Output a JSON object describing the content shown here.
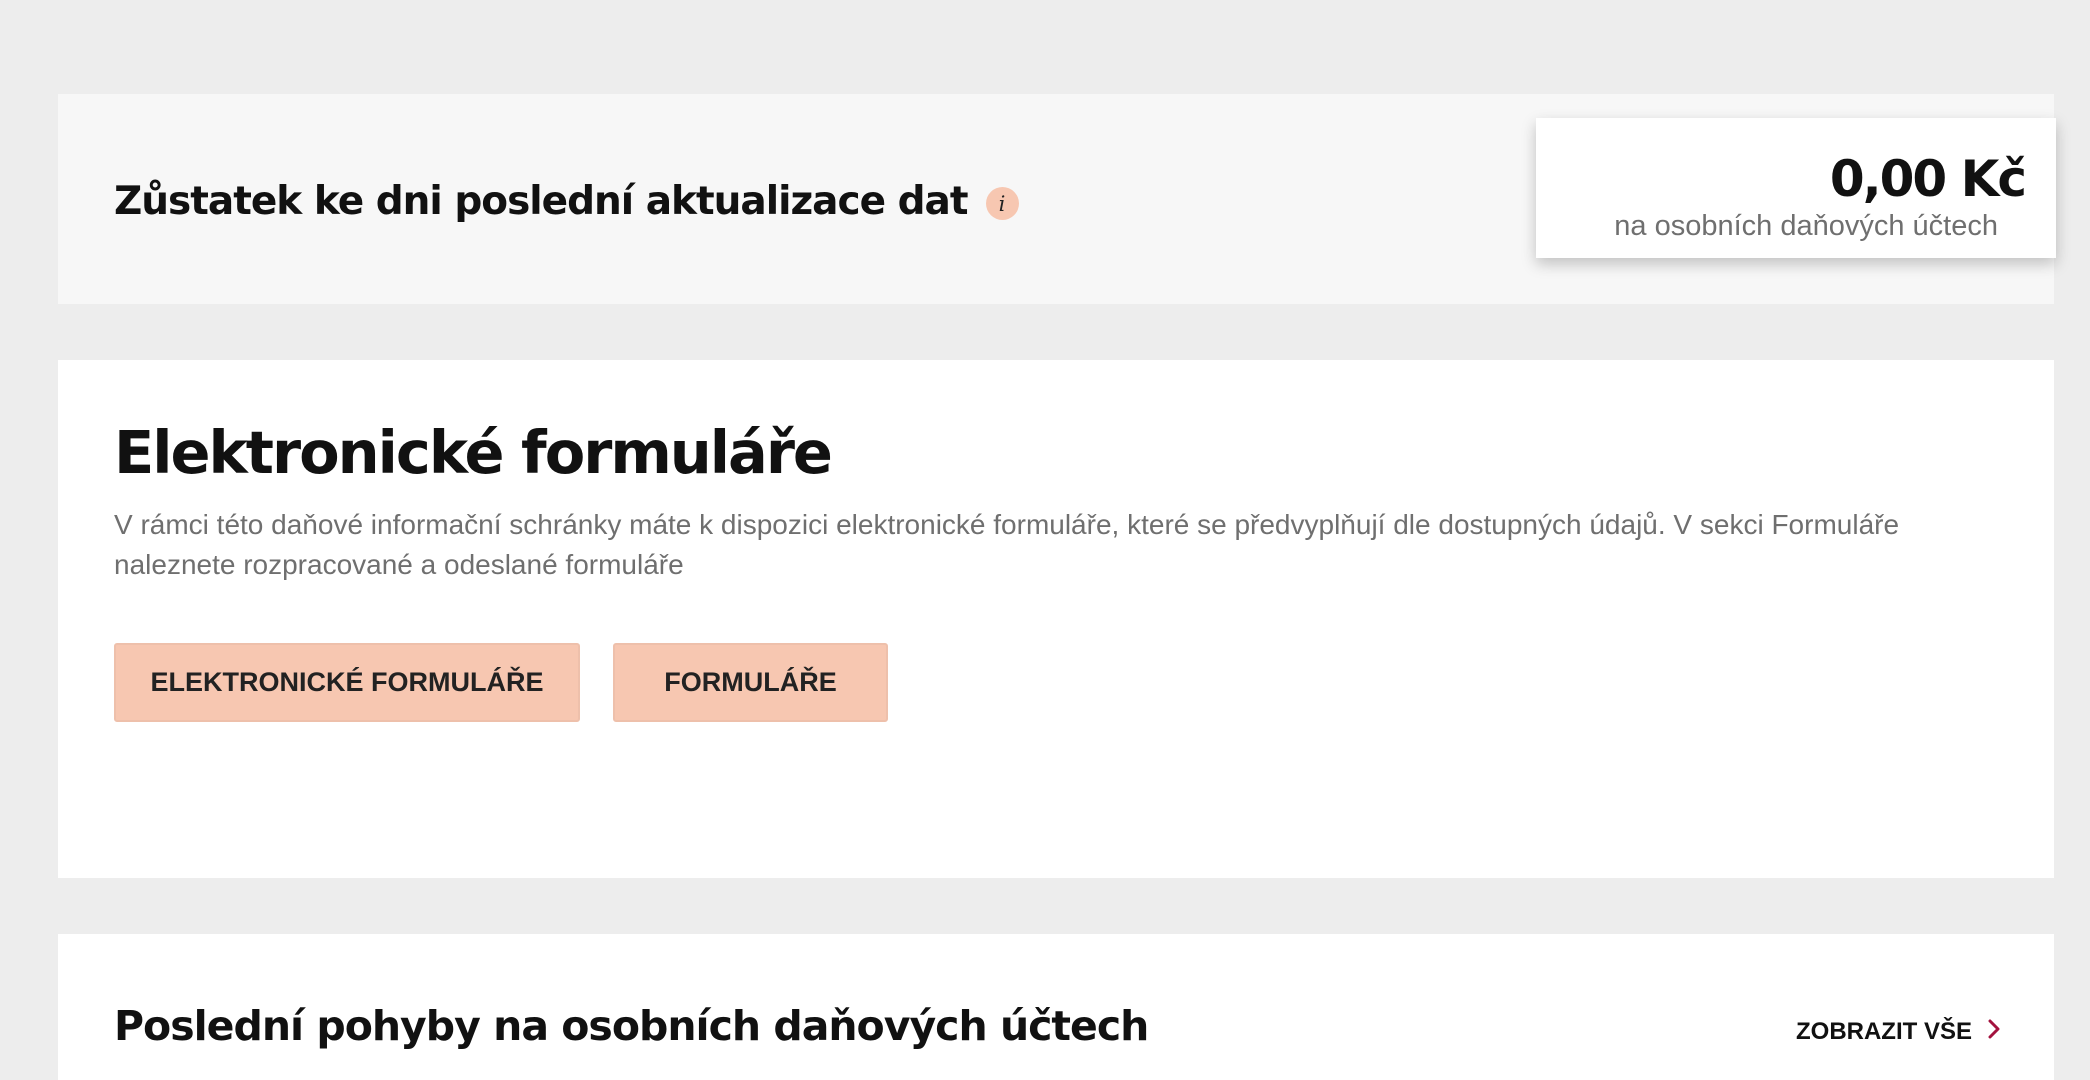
{
  "balance": {
    "title": "Zůstatek ke dni poslední aktualizace dat",
    "info_icon": "i",
    "amount": "0,00 Kč",
    "caption": "na osobních daňových účtech"
  },
  "forms": {
    "title": "Elektronické formuláře",
    "description": "V rámci této daňové informační schránky máte k dispozici elektronické formuláře, které se předvyplňují dle dostupných údajů. V sekci Formuláře naleznete rozpracované a odeslané formuláře",
    "buttons": {
      "eforms_label": "ELEKTRONICKÉ FORMULÁŘE",
      "forms_label": "FORMULÁŘE"
    }
  },
  "movements": {
    "title": "Poslední pohyby na osobních daňových účtech",
    "show_all_label": "ZOBRAZIT VŠE",
    "show_all_icon": "chevron-right-icon"
  },
  "colors": {
    "page_background": "#ededed",
    "accent_button": "#f7c7b1",
    "chevron": "#a3123e"
  }
}
